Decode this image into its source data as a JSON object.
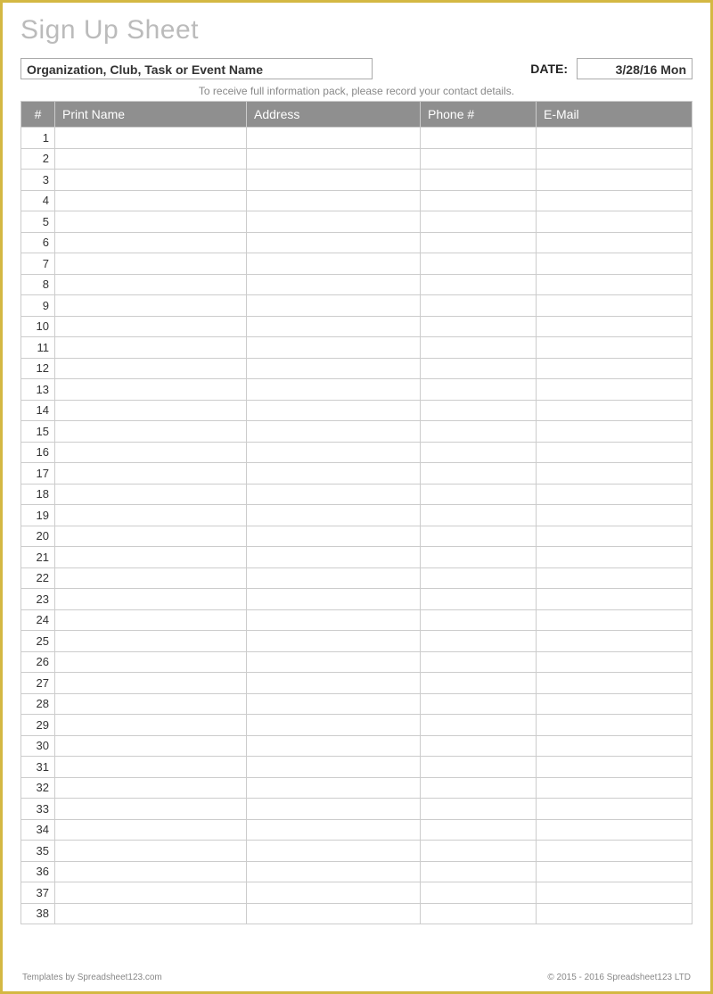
{
  "title": "Sign Up Sheet",
  "org_placeholder": "Organization, Club, Task or Event Name",
  "date_label": "DATE:",
  "date_value": "3/28/16 Mon",
  "subtitle": "To receive full information pack, please record your contact details.",
  "columns": {
    "num": "#",
    "name": "Print Name",
    "address": "Address",
    "phone": "Phone #",
    "email": "E-Mail"
  },
  "rows": [
    {
      "num": "1",
      "name": "",
      "address": "",
      "phone": "",
      "email": ""
    },
    {
      "num": "2",
      "name": "",
      "address": "",
      "phone": "",
      "email": ""
    },
    {
      "num": "3",
      "name": "",
      "address": "",
      "phone": "",
      "email": ""
    },
    {
      "num": "4",
      "name": "",
      "address": "",
      "phone": "",
      "email": ""
    },
    {
      "num": "5",
      "name": "",
      "address": "",
      "phone": "",
      "email": ""
    },
    {
      "num": "6",
      "name": "",
      "address": "",
      "phone": "",
      "email": ""
    },
    {
      "num": "7",
      "name": "",
      "address": "",
      "phone": "",
      "email": ""
    },
    {
      "num": "8",
      "name": "",
      "address": "",
      "phone": "",
      "email": ""
    },
    {
      "num": "9",
      "name": "",
      "address": "",
      "phone": "",
      "email": ""
    },
    {
      "num": "10",
      "name": "",
      "address": "",
      "phone": "",
      "email": ""
    },
    {
      "num": "11",
      "name": "",
      "address": "",
      "phone": "",
      "email": ""
    },
    {
      "num": "12",
      "name": "",
      "address": "",
      "phone": "",
      "email": ""
    },
    {
      "num": "13",
      "name": "",
      "address": "",
      "phone": "",
      "email": ""
    },
    {
      "num": "14",
      "name": "",
      "address": "",
      "phone": "",
      "email": ""
    },
    {
      "num": "15",
      "name": "",
      "address": "",
      "phone": "",
      "email": ""
    },
    {
      "num": "16",
      "name": "",
      "address": "",
      "phone": "",
      "email": ""
    },
    {
      "num": "17",
      "name": "",
      "address": "",
      "phone": "",
      "email": ""
    },
    {
      "num": "18",
      "name": "",
      "address": "",
      "phone": "",
      "email": ""
    },
    {
      "num": "19",
      "name": "",
      "address": "",
      "phone": "",
      "email": ""
    },
    {
      "num": "20",
      "name": "",
      "address": "",
      "phone": "",
      "email": ""
    },
    {
      "num": "21",
      "name": "",
      "address": "",
      "phone": "",
      "email": ""
    },
    {
      "num": "22",
      "name": "",
      "address": "",
      "phone": "",
      "email": ""
    },
    {
      "num": "23",
      "name": "",
      "address": "",
      "phone": "",
      "email": ""
    },
    {
      "num": "24",
      "name": "",
      "address": "",
      "phone": "",
      "email": ""
    },
    {
      "num": "25",
      "name": "",
      "address": "",
      "phone": "",
      "email": ""
    },
    {
      "num": "26",
      "name": "",
      "address": "",
      "phone": "",
      "email": ""
    },
    {
      "num": "27",
      "name": "",
      "address": "",
      "phone": "",
      "email": ""
    },
    {
      "num": "28",
      "name": "",
      "address": "",
      "phone": "",
      "email": ""
    },
    {
      "num": "29",
      "name": "",
      "address": "",
      "phone": "",
      "email": ""
    },
    {
      "num": "30",
      "name": "",
      "address": "",
      "phone": "",
      "email": ""
    },
    {
      "num": "31",
      "name": "",
      "address": "",
      "phone": "",
      "email": ""
    },
    {
      "num": "32",
      "name": "",
      "address": "",
      "phone": "",
      "email": ""
    },
    {
      "num": "33",
      "name": "",
      "address": "",
      "phone": "",
      "email": ""
    },
    {
      "num": "34",
      "name": "",
      "address": "",
      "phone": "",
      "email": ""
    },
    {
      "num": "35",
      "name": "",
      "address": "",
      "phone": "",
      "email": ""
    },
    {
      "num": "36",
      "name": "",
      "address": "",
      "phone": "",
      "email": ""
    },
    {
      "num": "37",
      "name": "",
      "address": "",
      "phone": "",
      "email": ""
    },
    {
      "num": "38",
      "name": "",
      "address": "",
      "phone": "",
      "email": ""
    }
  ],
  "footer_left": "Templates by Spreadsheet123.com",
  "footer_right": "© 2015 - 2016 Spreadsheet123 LTD"
}
